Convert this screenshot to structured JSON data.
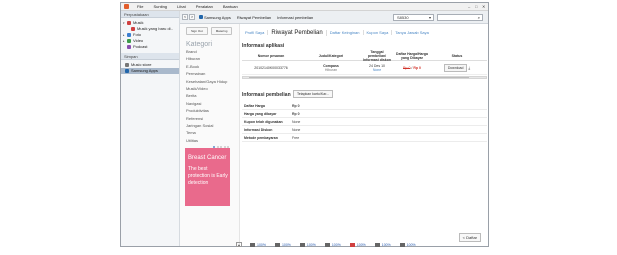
{
  "menu": [
    "File",
    "Sunting",
    "Lihat",
    "Peralatan",
    "Bantuan"
  ],
  "sidebar": {
    "sec1_title": "Perpustakaan",
    "items": [
      {
        "label": "Musik",
        "icon": "music-note-icon",
        "color": "#d04040"
      },
      {
        "label": "Musik yang baru di..",
        "icon": "music-note-icon",
        "color": "#d04040"
      },
      {
        "label": "Foto",
        "icon": "photo-icon",
        "color": "#3c7ed0"
      },
      {
        "label": "Video",
        "icon": "video-icon",
        "color": "#3c9a4a"
      },
      {
        "label": "Podcast",
        "icon": "podcast-icon",
        "color": "#8a4fb0"
      }
    ],
    "sec2_title": "Simpan",
    "items2": [
      {
        "label": "Music store",
        "icon": "store-icon",
        "color": "#777"
      },
      {
        "label": "Samsung Apps",
        "icon": "samsung-apps-icon",
        "color": "#2266aa"
      }
    ]
  },
  "nav": {
    "samsung_apps": "Samsung Apps",
    "crumb1": "Riwayat Pembelian",
    "crumb2": "Informasi pembelian",
    "device": "S8530",
    "back": "<",
    "fwd": ">"
  },
  "store": {
    "signout": "Sign Out",
    "markets": "Matering",
    "kategori_title": "Kategori",
    "categories": [
      "Brand",
      "Hiburan",
      "E-Book",
      "Permainan",
      "Kesehatan/Gaya Hidup",
      "Musik/Video",
      "Berita",
      "Navigasi",
      "Produktivitas",
      "Referensi",
      "Jaringan Sosial",
      "Tema",
      "Utilitas"
    ],
    "promo_title": "Breast Cancer",
    "promo_text": "The best protection is Early detection"
  },
  "tabs": [
    "Profil Saya",
    "Riwayat Pembelian",
    "Daftar Keinginan",
    "Kupon Saya",
    "Tanya Jawab Saya"
  ],
  "appinfo": {
    "title": "Informasi aplikasi",
    "headers": [
      "Nomor pesanan",
      "Judul/Kategori",
      "Tanggal pembelian/ Informasi diskon",
      "Daftar Harga/Harga yang Dibayar",
      "Status"
    ],
    "row": {
      "order": "20102140K00033776",
      "title": "Compass",
      "category": "Hiburan",
      "date": "24 Des 10",
      "date_sub": "None",
      "price_list": "Rp 0",
      "price_paid": "Rp 0",
      "status": "Download"
    }
  },
  "purchase": {
    "title": "Informasi pembelian",
    "detail_button": "Tetapkan kartu/Kar...",
    "rows": [
      {
        "label": "Daftar Harga",
        "value": "Rp 0",
        "red": true
      },
      {
        "label": "Harga yang dibayar",
        "value": "Rp 0",
        "red": true
      },
      {
        "label": "Kupon telah digunakan",
        "value": "None",
        "red": false
      },
      {
        "label": "Informasi Diskon",
        "value": "None",
        "red": false
      },
      {
        "label": "Metode pembayaran",
        "value": "Free",
        "red": false
      }
    ]
  },
  "list_button": "< Daftar",
  "taskbar": [
    "100%",
    "100%",
    "100%",
    "100%",
    "100%",
    "100%",
    "100%"
  ]
}
